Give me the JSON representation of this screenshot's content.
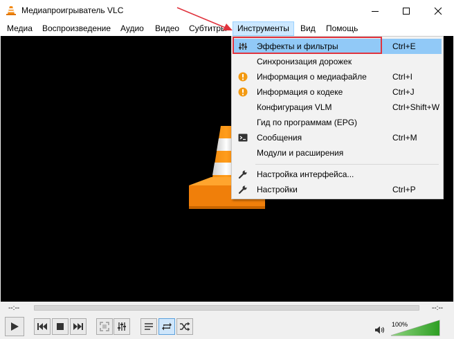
{
  "window": {
    "title": "Медиапроигрыватель VLC",
    "icon": "vlc-cone-icon",
    "buttons": [
      "minimize-icon",
      "maximize-icon",
      "close-icon"
    ]
  },
  "menubar": {
    "items": [
      {
        "label": "Медиа"
      },
      {
        "label": "Воспроизведение"
      },
      {
        "label": "Аудио"
      },
      {
        "label": "Видео"
      },
      {
        "label": "Субтитры"
      },
      {
        "label": "Инструменты",
        "active": true
      },
      {
        "label": "Вид"
      },
      {
        "label": "Помощь"
      }
    ]
  },
  "tools_menu": {
    "items": [
      {
        "label": "Эффекты и фильтры",
        "shortcut": "Ctrl+E",
        "icon": "equalizer-icon",
        "selected": true
      },
      {
        "label": "Синхронизация дорожек",
        "shortcut": "",
        "icon": ""
      },
      {
        "label": "Информация о медиафайле",
        "shortcut": "Ctrl+I",
        "icon": "info-icon"
      },
      {
        "label": "Информация о кодеке",
        "shortcut": "Ctrl+J",
        "icon": "info-icon"
      },
      {
        "label": "Конфигурация VLM",
        "shortcut": "Ctrl+Shift+W",
        "icon": ""
      },
      {
        "label": "Гид по программам (EPG)",
        "shortcut": "",
        "icon": ""
      },
      {
        "label": "Сообщения",
        "shortcut": "Ctrl+M",
        "icon": "console-icon"
      },
      {
        "label": "Модули и расширения",
        "shortcut": "",
        "icon": ""
      },
      {
        "label": "Настройка интерфейса...",
        "shortcut": "",
        "icon": "wrench-icon"
      },
      {
        "label": "Настройки",
        "shortcut": "Ctrl+P",
        "icon": "wrench-icon"
      }
    ]
  },
  "player": {
    "time_elapsed": "--:--",
    "time_total": "--:--",
    "seek_progress": 0,
    "volume_label": "100%",
    "volume_level": 1.0
  },
  "colors": {
    "menu_active_bg": "#cce8ff",
    "menu_selected_bg": "#91c9f7",
    "annotation_red": "#e0333d",
    "info_orange": "#f39a12",
    "volume_green": "#3cb030"
  }
}
